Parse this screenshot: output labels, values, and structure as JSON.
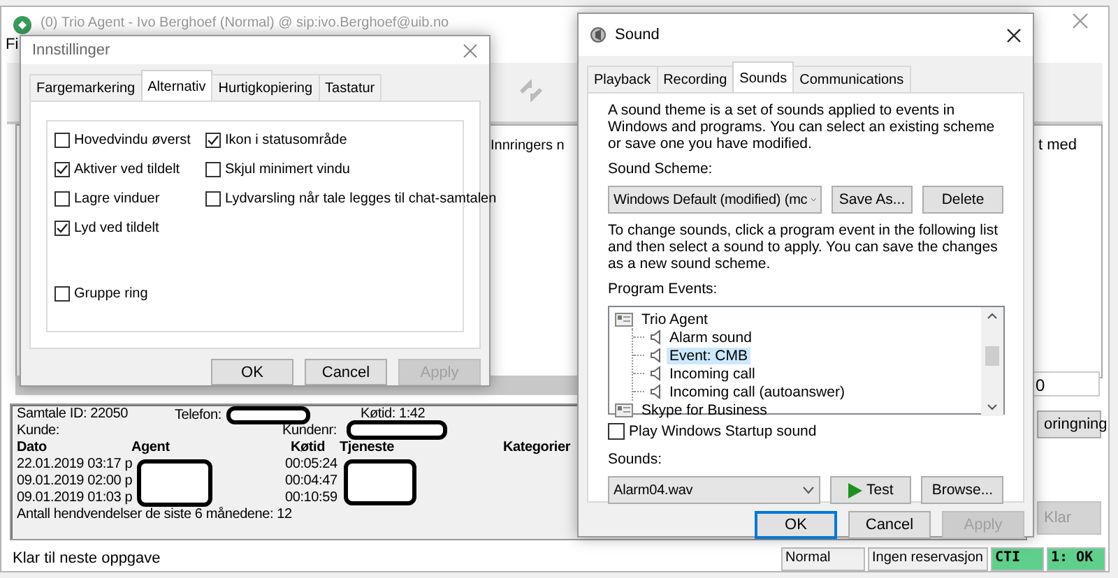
{
  "main_window": {
    "title": "(0) Trio Agent - Ivo Berghoef (Normal) @ sip:ivo.Berghoef@uib.no",
    "menu": [
      "Fi"
    ],
    "caller_header": "Innringers n",
    "column_fragment": "t med",
    "counter_fragment": "0",
    "side_buttons": [
      {
        "label": "oringning",
        "disabled": false
      },
      {
        "label": "Klar",
        "disabled": true
      }
    ],
    "info": {
      "call_id": "Samtale ID: 22050",
      "phone_label": "Telefon:",
      "queue_time": "Køtid:  1:42",
      "customer_label": "Kunde:",
      "customer_no_label": "Kundenr:",
      "columns": [
        "Dato",
        "Agent",
        "Køtid",
        "Tjeneste",
        "Kategorier"
      ],
      "rows": [
        {
          "date": "22.01.2019 03:17 p",
          "queue_time": "00:05:24"
        },
        {
          "date": "09.01.2019 02:00 p",
          "queue_time": "00:04:47"
        },
        {
          "date": "09.01.2019 01:03 p",
          "queue_time": "00:10:59"
        }
      ],
      "summary": "Antall hendvendelser de siste 6 månedene: 12"
    },
    "status_bar": {
      "message": "Klar til neste oppgave",
      "fields": [
        {
          "text": "Normal",
          "kind": "plain"
        },
        {
          "text": "Ingen reservasjon",
          "kind": "plain"
        },
        {
          "text": "CTI",
          "kind": "ok"
        },
        {
          "text": "1: OK",
          "kind": "ok"
        }
      ]
    }
  },
  "settings_dialog": {
    "title": "Innstillinger",
    "tabs": [
      {
        "label": "Fargemarkering",
        "selected": false
      },
      {
        "label": "Alternativ",
        "selected": true
      },
      {
        "label": "Hurtigkopiering",
        "selected": false
      },
      {
        "label": "Tastatur",
        "selected": false
      }
    ],
    "options": [
      {
        "label": "Hovedvindu øverst",
        "checked": false
      },
      {
        "label": "Ikon i statusområde",
        "checked": true
      },
      {
        "label": "Aktiver ved tildelt",
        "checked": true
      },
      {
        "label": "Skjul minimert vindu",
        "checked": false
      },
      {
        "label": "Lagre vinduer",
        "checked": false
      },
      {
        "label": "Lydvarsling når tale legges til chat-samtalen",
        "checked": false
      },
      {
        "label": "Lyd ved tildelt",
        "checked": true
      }
    ],
    "extra_options": [
      {
        "label": "Gruppe ring",
        "checked": false
      }
    ],
    "buttons": [
      {
        "label": "OK",
        "disabled": false
      },
      {
        "label": "Cancel",
        "disabled": false
      },
      {
        "label": "Apply",
        "disabled": true
      }
    ]
  },
  "sound_dialog": {
    "title": "Sound",
    "tabs": [
      {
        "label": "Playback",
        "selected": false
      },
      {
        "label": "Recording",
        "selected": false
      },
      {
        "label": "Sounds",
        "selected": true
      },
      {
        "label": "Communications",
        "selected": false
      }
    ],
    "intro": "A sound theme is a set of sounds applied to events in Windows and programs.  You can select an existing scheme or save one you have modified.",
    "scheme_label": "Sound Scheme:",
    "scheme_value": "Windows Default (modified) (mc",
    "scheme_buttons": [
      "Save As...",
      "Delete"
    ],
    "instructions": "To change sounds, click a program event in the following list and then select a sound to apply.  You can save the changes as a new sound scheme.",
    "events_label": "Program Events:",
    "events": [
      {
        "label": "Trio Agent",
        "selected": false,
        "children": [
          {
            "label": "Alarm sound",
            "selected": false
          },
          {
            "label": "Event: CMB",
            "selected": true
          },
          {
            "label": "Incoming call",
            "selected": false
          },
          {
            "label": "Incoming call (autoanswer)",
            "selected": false
          }
        ]
      },
      {
        "label": "Skype for Business",
        "selected": false
      }
    ],
    "startup_sound": {
      "label": "Play Windows Startup sound",
      "checked": false
    },
    "sounds_label": "Sounds:",
    "sound_value": "Alarm04.wav",
    "sound_buttons": [
      {
        "label": "Test",
        "kind": "play"
      },
      {
        "label": "Browse...",
        "kind": "plain"
      }
    ],
    "buttons": [
      {
        "label": "OK",
        "disabled": false,
        "default": true
      },
      {
        "label": "Cancel",
        "disabled": false,
        "default": false
      },
      {
        "label": "Apply",
        "disabled": true,
        "default": false
      }
    ]
  }
}
